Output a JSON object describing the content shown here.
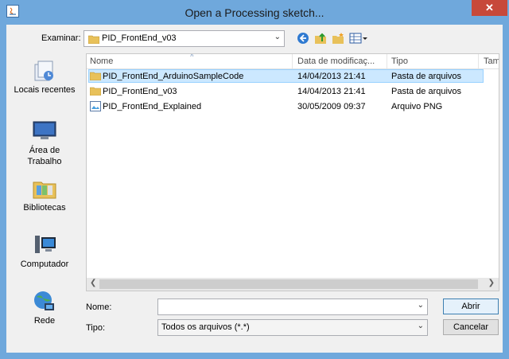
{
  "window": {
    "title": "Open a Processing sketch...",
    "close_glyph": "✕"
  },
  "lookin": {
    "label": "Examinar:",
    "value": "PID_FrontEnd_v03"
  },
  "toolbar": {
    "icons": [
      "back-icon",
      "up-folder-icon",
      "new-folder-icon",
      "view-menu-icon"
    ]
  },
  "places": [
    {
      "label": "Locais recentes",
      "icon": "recent-places-icon"
    },
    {
      "label": "Área de Trabalho",
      "icon": "desktop-icon"
    },
    {
      "label": "Bibliotecas",
      "icon": "libraries-icon"
    },
    {
      "label": "Computador",
      "icon": "computer-icon"
    },
    {
      "label": "Rede",
      "icon": "network-icon"
    }
  ],
  "columns": [
    "Nome",
    "Data de modificaç...",
    "Tipo",
    "Tam"
  ],
  "files": [
    {
      "name": "PID_FrontEnd_ArduinoSampleCode",
      "date": "14/04/2013 21:41",
      "type": "Pasta de arquivos",
      "icon": "folder-icon",
      "selected": true
    },
    {
      "name": "PID_FrontEnd_v03",
      "date": "14/04/2013 21:41",
      "type": "Pasta de arquivos",
      "icon": "folder-icon",
      "selected": false
    },
    {
      "name": "PID_FrontEnd_Explained",
      "date": "30/05/2009 09:37",
      "type": "Arquivo PNG",
      "icon": "image-file-icon",
      "selected": false
    }
  ],
  "filename": {
    "label": "Nome:",
    "value": ""
  },
  "filetype": {
    "label": "Tipo:",
    "value": "Todos os arquivos (*.*)"
  },
  "buttons": {
    "open": "Abrir",
    "cancel": "Cancelar"
  },
  "colors": {
    "titlebar": "#6fa8dc",
    "selection": "#cce8ff",
    "close": "#c7493a"
  }
}
